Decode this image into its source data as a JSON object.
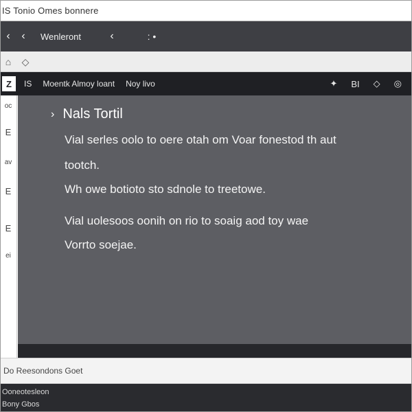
{
  "window": {
    "title": "IS Tonio Omes bonnere"
  },
  "navbar": {
    "back_icon_1": "‹",
    "back_icon_2": "‹",
    "title": "Wenleront",
    "chevron": "‹",
    "more_icon": ": •"
  },
  "toolbar": {
    "icon_1": "⌂",
    "icon_2": "◇"
  },
  "panel": {
    "icon_label": "Z",
    "path_1": "IS",
    "path_2": "Moentk Almoy loant",
    "path_3": "Noy livo",
    "right_1": "✦",
    "right_2": "BI",
    "right_3": "◇",
    "right_4": "◎"
  },
  "sidebar": {
    "items": [
      "oc",
      "E",
      "av",
      "E",
      "E",
      "ei"
    ]
  },
  "content": {
    "heading": "Nals Tortil",
    "lines": [
      "Vial serles oolo to oere otah om Voar fonestod th aut",
      "tootch.",
      "Wh owe botioto sto sdnole to treetowe.",
      "Vial uolesoos oonih on rio to soaig aod toy wae",
      "Vorrto soejae."
    ]
  },
  "statusbar": {
    "text": "Do Reesondons Goet"
  },
  "bottombar": {
    "line_1": "Ooneotesleon",
    "line_2": "Bony Gbos"
  }
}
